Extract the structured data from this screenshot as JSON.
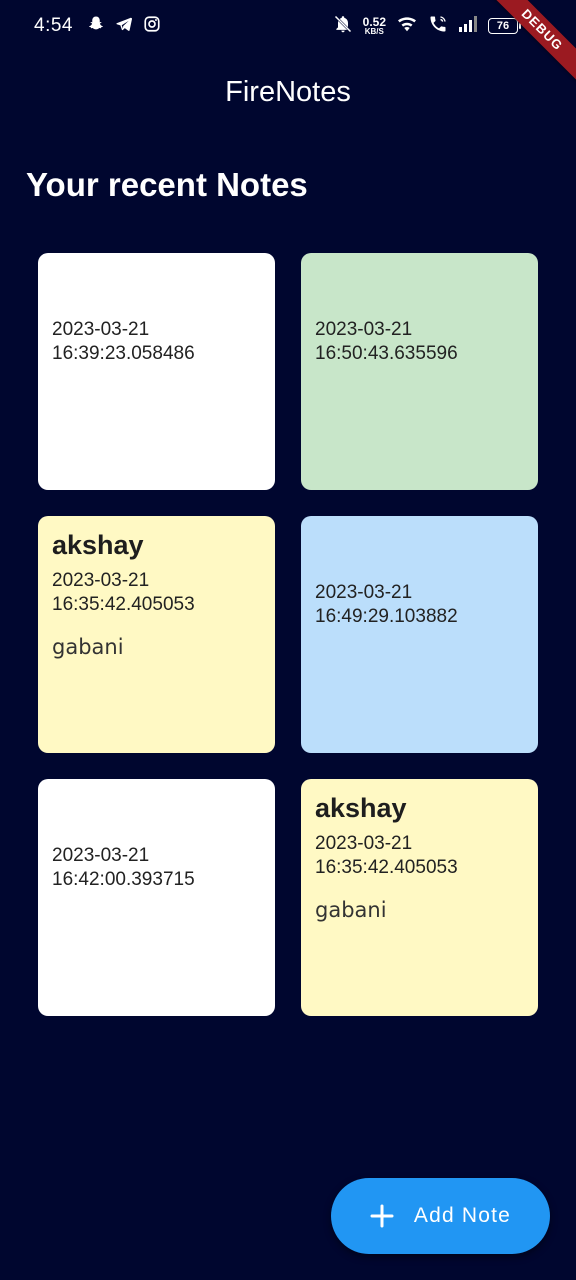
{
  "status_bar": {
    "time": "4:54",
    "net_speed_value": "0.52",
    "net_speed_unit": "KB/S",
    "battery": "76",
    "left_icons": [
      "snapchat-icon",
      "telegram-icon",
      "instagram-icon"
    ],
    "right_icons": [
      "mute-icon",
      "wifi-icon",
      "wifi-call-icon",
      "signal-icon",
      "battery-icon"
    ]
  },
  "debug_banner": "DEBUG",
  "app_bar": {
    "title": "FireNotes"
  },
  "section": {
    "title": "Your recent Notes"
  },
  "notes": [
    {
      "title": "",
      "date": "2023-03-21\n16:39:23.058486",
      "body": "",
      "color": "#ffffff"
    },
    {
      "title": "",
      "date": "2023-03-21\n16:50:43.635596",
      "body": "",
      "color": "#c8e6c9"
    },
    {
      "title": "akshay",
      "date": "2023-03-21\n16:35:42.405053",
      "body": "gabani",
      "color": "#fff9c4"
    },
    {
      "title": "",
      "date": "2023-03-21\n16:49:29.103882",
      "body": "",
      "color": "#bbdefb"
    },
    {
      "title": "",
      "date": "2023-03-21\n16:42:00.393715",
      "body": "",
      "color": "#ffffff"
    },
    {
      "title": "akshay",
      "date": "2023-03-21\n16:35:42.405053",
      "body": "gabani",
      "color": "#fff9c4"
    }
  ],
  "fab": {
    "label": "Add Note",
    "icon": "plus-icon",
    "color": "#2196f3"
  },
  "colors": {
    "background": "#00062f"
  }
}
